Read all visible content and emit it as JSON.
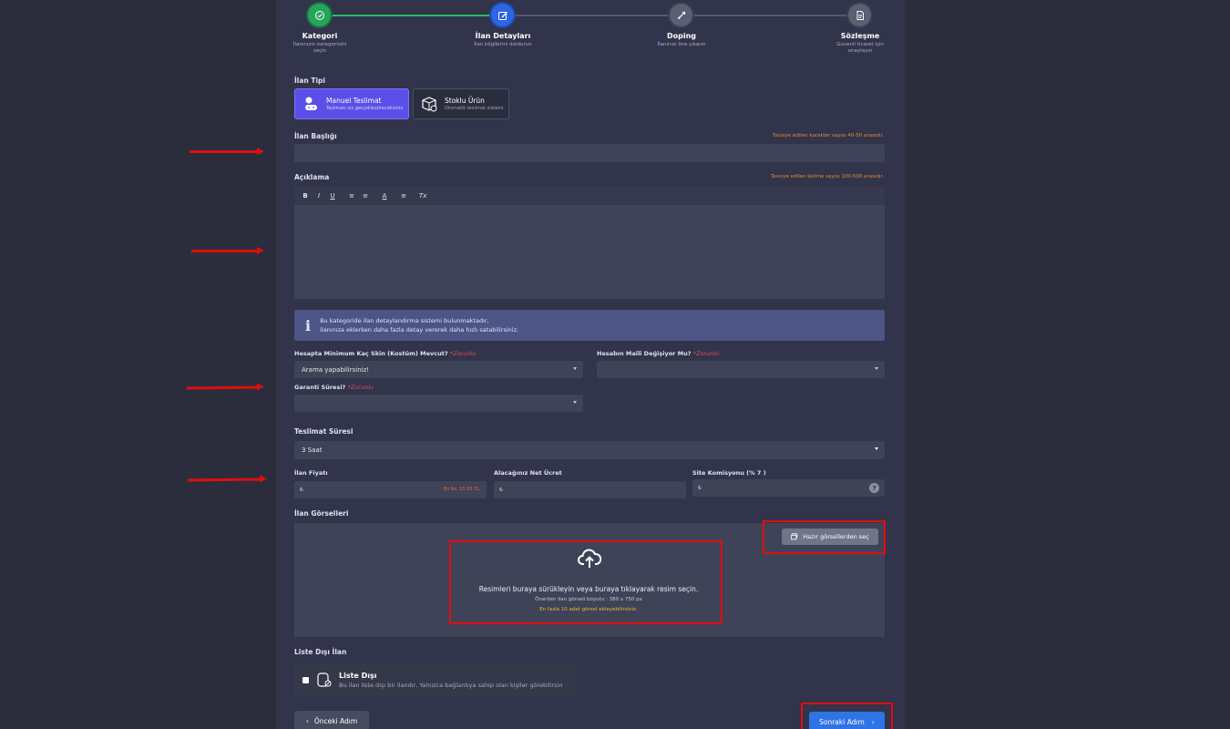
{
  "steps": [
    {
      "title": "Kategori",
      "sub": "İlanınızın kategorisini seçin",
      "state": "done"
    },
    {
      "title": "İlan Detayları",
      "sub": "İlan bilgilerini doldurun",
      "state": "active"
    },
    {
      "title": "Doping",
      "sub": "İlanınızı öne çıkarın",
      "state": "pending"
    },
    {
      "title": "Sözleşme",
      "sub": "Güvenli ticaret için onaylayın",
      "state": "pending"
    }
  ],
  "ilan_tipi": {
    "label": "İlan Tipi",
    "manual": {
      "title": "Manuel Teslimat",
      "sub": "Teslimatı siz gerçekleştireceksiniz."
    },
    "stock": {
      "title": "Stoklu Ürün",
      "sub": "Otomatik teslimat sistemi."
    }
  },
  "title_field": {
    "label": "İlan Başlığı",
    "hint": "Tavsiye edilen karakter sayısı 40-50 arasıdır.",
    "value": ""
  },
  "description": {
    "label": "Açıklama",
    "hint": "Tavsiye edilen kelime sayısı 100-500 arasıdır.",
    "toolbar": [
      "B",
      "I",
      "U",
      "≡",
      "≡",
      "A",
      "≡",
      "Tx"
    ]
  },
  "info": {
    "line1": "Bu kategoride ilan detaylandırma sistemi bulunmaktadır,",
    "line2": "ilanınıza eklerken daha fazla detay vererek daha hızlı satabilirsiniz."
  },
  "fields": {
    "skin": {
      "label": "Hesapta Minimum Kaç Skin (Kostüm) Mevcut?",
      "required": "*Zorunlu",
      "value": "Arama yapabilirsiniz!"
    },
    "mail": {
      "label": "Hesabın Maili Değişiyor Mu?",
      "required": "*Zorunlu",
      "value": ""
    },
    "guarantee": {
      "label": "Garanti Süresi?",
      "required": "*Zorunlu",
      "value": ""
    },
    "delivery": {
      "label": "Teslimat Süresi",
      "value": "3 Saat"
    }
  },
  "pricing": {
    "price_label": "İlan Fiyatı",
    "price_currency": "₺",
    "price_min": "En Az: 15.00 TL",
    "net_label": "Alacağınız Net Ücret",
    "net_currency": "₺",
    "commission_label": "Site Komisyonu (% 7 )",
    "commission_currency": "₺",
    "help": "?"
  },
  "images": {
    "label": "İlan Görselleri",
    "ready_button": "Hazır görsellerden seç",
    "drop_text": "Resimleri buraya sürükleyin veya buraya tıklayarak resim seçin.",
    "size_text": "Önerilen ilan görseli boyutu : 380 x 750 px",
    "limit_text": "En fazla 10 adet görsel ekleyebilirsiniz."
  },
  "unlisted": {
    "section_label": "Liste Dışı İlan",
    "title": "Liste Dışı",
    "desc": "Bu ilan liste dışı bir ilandır, Yalnızca bağlantıya sahip olan kişiler görebilirsin"
  },
  "nav": {
    "prev": "Önceki Adım",
    "next": "Sonraki Adım"
  },
  "colors": {
    "accent": "#2f74e6",
    "success": "#25a55a",
    "selected": "#5a4fe8",
    "annotation": "#e10d0d"
  }
}
